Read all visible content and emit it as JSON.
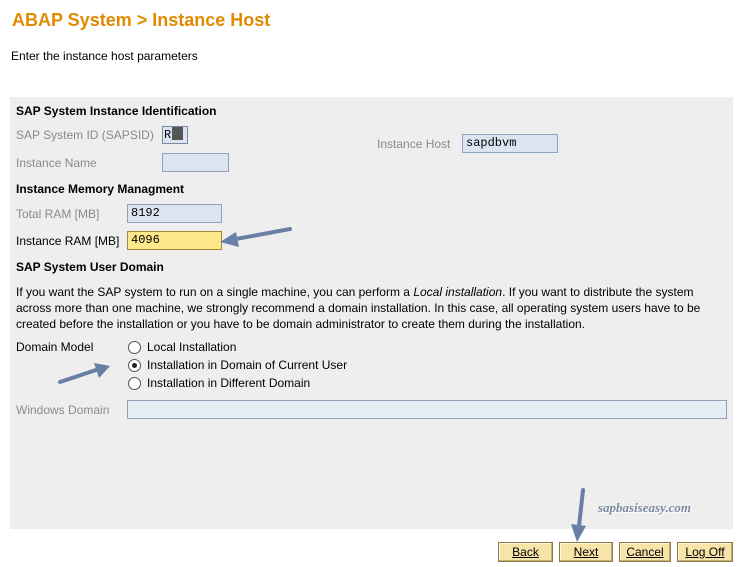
{
  "header": {
    "title": "ABAP System > Instance Host",
    "subtitle": "Enter the instance host parameters"
  },
  "identification": {
    "heading": "SAP System Instance Identification",
    "sapsid_label": "SAP System ID (SAPSID)",
    "sapsid_value": "R",
    "instance_host_label": "Instance Host",
    "instance_host_value": "sapdbvm",
    "instance_name_label": "Instance Name",
    "instance_name_value": ""
  },
  "memory": {
    "heading": "Instance Memory Managment",
    "total_ram_label": "Total RAM [MB]",
    "total_ram_value": "8192",
    "instance_ram_label": "Instance RAM [MB]",
    "instance_ram_value": "4096"
  },
  "domain": {
    "heading": "SAP System User Domain",
    "description_before": "If you want the SAP system to run on a single machine, you can perform a ",
    "description_italic": "Local installation",
    "description_after": ". If you want to distribute the system across more than one machine, we strongly recommend a domain installation. In this case, all operating system users have to be created before the installation or you have to be domain administrator to create them during the installation.",
    "model_label": "Domain Model",
    "options": [
      {
        "label": "Local Installation",
        "selected": false
      },
      {
        "label": "Installation in Domain of Current User",
        "selected": true
      },
      {
        "label": "Installation in Different Domain",
        "selected": false
      }
    ],
    "windows_domain_label": "Windows Domain",
    "windows_domain_value": ""
  },
  "buttons": {
    "back": "Back",
    "next": "Next",
    "cancel": "Cancel",
    "logoff": "Log Off"
  },
  "watermark": "sapbasiseasy.com",
  "colors": {
    "title": "#e08a00",
    "panel": "#eeeeee",
    "field": "#dbe4f0",
    "active_field": "#ffe88a",
    "button": "#f6e4a8",
    "arrow": "#6a7fa6"
  }
}
